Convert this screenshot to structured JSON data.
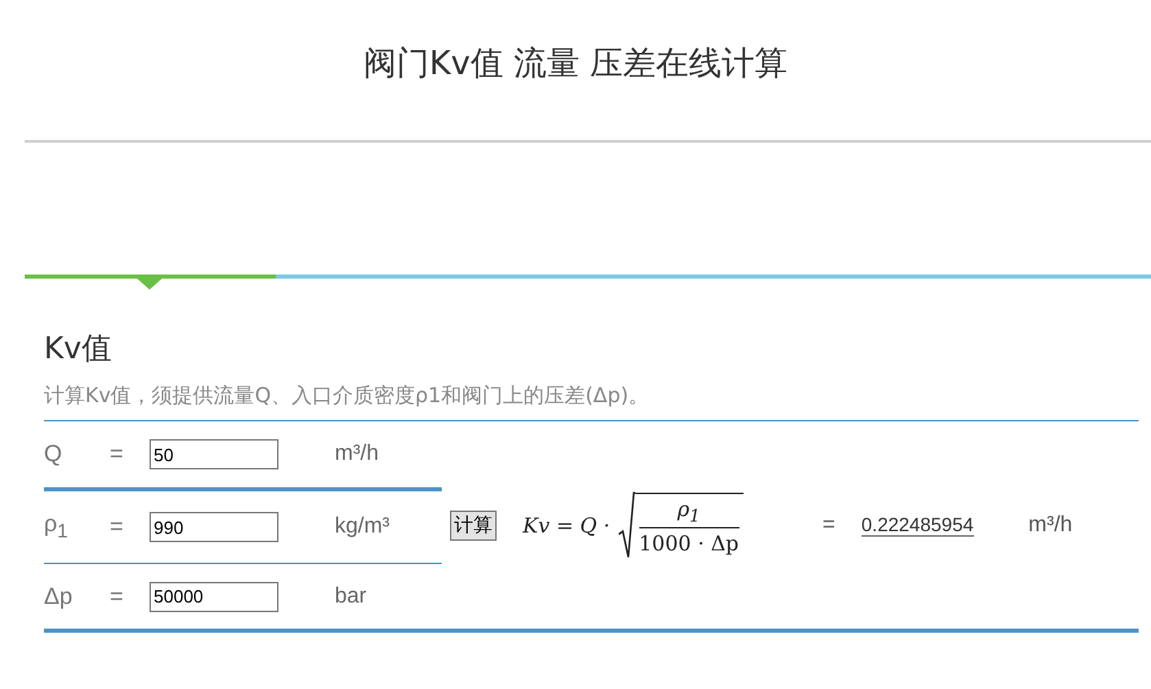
{
  "page": {
    "title": "阀门Kv值 流量 压差在线计算"
  },
  "tabs": [
    {
      "selected": true
    },
    {
      "selected": false
    }
  ],
  "section": {
    "heading": "Kv值",
    "description": "计算Kv值，须提供流量Q、入口介质密度ρ1和阀门上的压差(Δp)。"
  },
  "inputs": [
    {
      "symbol": "Q",
      "equals": "=",
      "value": "50",
      "unit": "m³/h"
    },
    {
      "symbol": "ρ$_{1}$",
      "equals": "=",
      "value": "990",
      "unit": "kg/m³"
    },
    {
      "symbol": "Δp",
      "equals": "=",
      "value": "50000",
      "unit": "bar"
    }
  ],
  "calculate_button": "计算",
  "formula": {
    "lhs": "Kv = Q ·",
    "numerator": "ρ$_{1}$",
    "denominator": "1000 · Δp"
  },
  "result": {
    "equals": "=",
    "value": "0.222485954",
    "unit": "m³/h"
  }
}
